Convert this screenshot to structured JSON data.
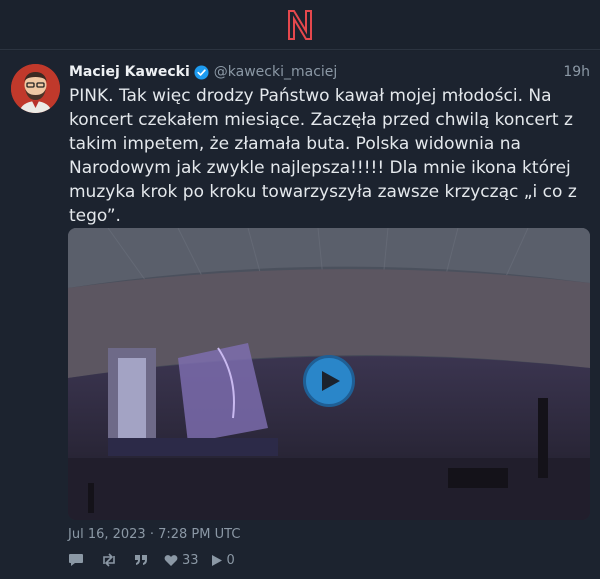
{
  "app": {
    "logo_name": "nitter-logo",
    "accent": "#e5484d"
  },
  "tweet": {
    "author_name": "Maciej Kawecki",
    "handle": "@kawecki_maciej",
    "verified": true,
    "time_ago": "19h",
    "text": "PINK. Tak więc drodzy Państwo kawał mojej młodości. Na koncert czekałem miesiące. Zaczęła przed chwilą koncert z takim impetem, że złamała buta. Polska widownia na Narodowym jak zwykle najlepsza!!!!! Dla mnie ikona której muzyka krok po kroku towarzyszyła zawsze krzycząc „i co z tego”.",
    "date": "Jul 16, 2023 · 7:28 PM UTC",
    "media": {
      "type": "video",
      "play_icon": "play-icon"
    },
    "stats": {
      "replies": "",
      "retweets": "",
      "quotes": "",
      "likes": "33",
      "views": "0"
    }
  },
  "colors": {
    "background": "#1b222d",
    "muted": "#8b98a5",
    "verified": "#1d9bf0",
    "play": "#2a86c9"
  }
}
